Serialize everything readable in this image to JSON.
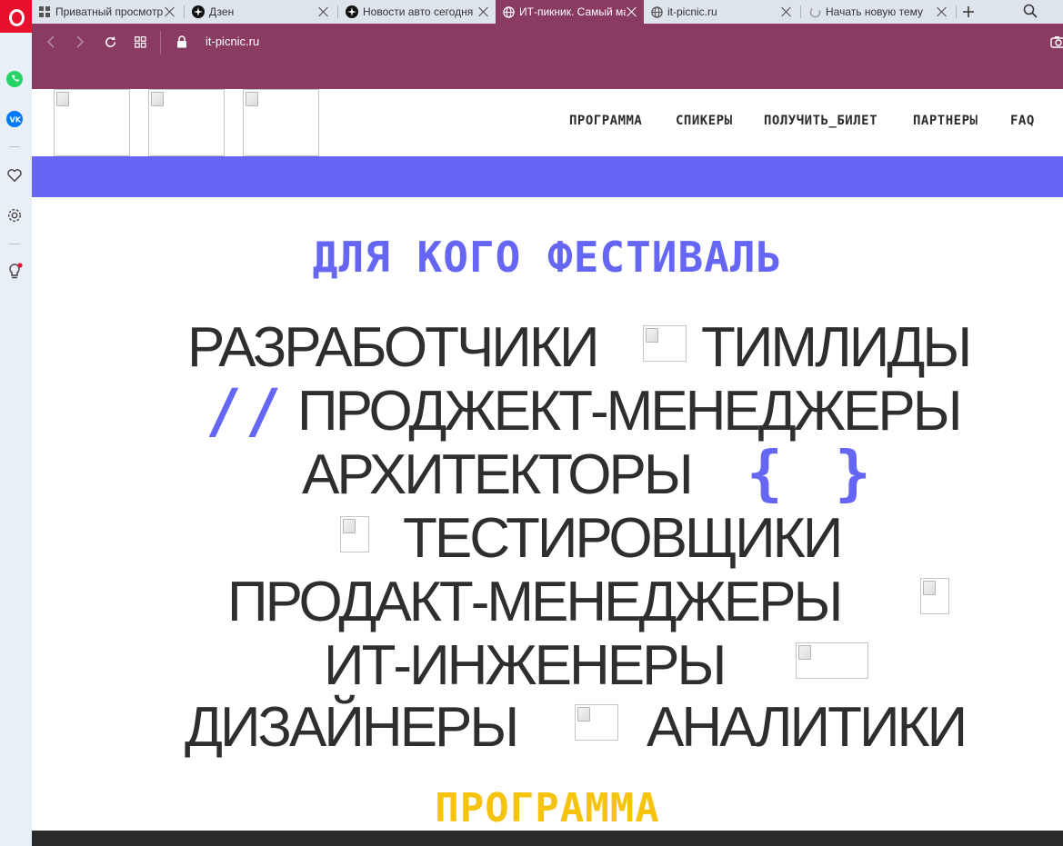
{
  "browser": {
    "tabs": [
      {
        "label": "Приватный просмотр",
        "icon": "grid-icon"
      },
      {
        "label": "Дзен",
        "icon": "zen-icon"
      },
      {
        "label": "Новости авто сегодня",
        "icon": "zen-icon"
      },
      {
        "label": "ИТ-пикник. Самый масштабный",
        "icon": "globe-icon",
        "active": true
      },
      {
        "label": "it-picnic.ru",
        "icon": "globe-icon"
      },
      {
        "label": "Начать новую тему",
        "icon": "loading-icon"
      }
    ],
    "address": "it-picnic.ru",
    "accent_color": "#8a3b62",
    "sidebar_icons": [
      "opera-icon",
      "whatsapp-icon",
      "vk-icon",
      "heart-icon",
      "gear-icon",
      "lightbulb-icon"
    ]
  },
  "site": {
    "menu": [
      "ПРОГРАММА",
      "СПИКЕРЫ",
      "ПОЛУЧИТЬ_БИЛЕТ",
      "ПАРТНЕРЫ",
      "FAQ"
    ],
    "section_title": "ДЛЯ КОГО ФЕСТИВАЛЬ",
    "section_title_color": "#6666f5",
    "roles": [
      "РАЗРАБОТЧИКИ",
      "ТИМЛИДЫ",
      "ПРОДЖЕКТ-МЕНЕДЖЕРЫ",
      "АРХИТЕКТОРЫ",
      "ТЕСТИРОВЩИКИ",
      "ПРОДАКТ-МЕНЕДЖЕРЫ",
      "ИТ-ИНЖЕНЕРЫ",
      "ДИЗАЙНЕРЫ",
      "АНАЛИТИКИ"
    ],
    "decorations": {
      "slashes": "//",
      "open_brace": "{",
      "close_brace": "}"
    },
    "next_section_title": "ПРОГРАММА",
    "next_section_color": "#f6c30f"
  }
}
